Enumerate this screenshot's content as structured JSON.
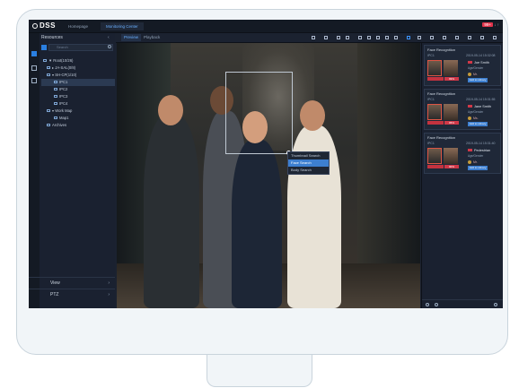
{
  "app": {
    "logo": "DSS",
    "tabs": [
      {
        "label": "Homepage"
      },
      {
        "label": "Monitoring Center"
      }
    ],
    "window_controls": {
      "badge": "99+",
      "text": "↓ ↑"
    }
  },
  "sidebar": {
    "title": "Resources",
    "search_placeholder": "Search",
    "tree": [
      {
        "label": "▼ Root(10/26)",
        "indent": 0
      },
      {
        "label": "▸ JA-SAL(0/8)",
        "indent": 1
      },
      {
        "label": "▾ SH-CP(1/10)",
        "indent": 1
      },
      {
        "label": "IPC1",
        "indent": 3
      },
      {
        "label": "IPC2",
        "indent": 3
      },
      {
        "label": "IPC3",
        "indent": 3
      },
      {
        "label": "IPC4",
        "indent": 3
      },
      {
        "label": "▾ Work Map",
        "indent": 1
      },
      {
        "label": "Map1",
        "indent": 3
      },
      {
        "label": "Archives",
        "indent": 1
      }
    ],
    "bottom": [
      {
        "label": "View"
      },
      {
        "label": "PTZ"
      }
    ]
  },
  "toolbar": {
    "tabs": [
      "Preview",
      "Playback"
    ]
  },
  "context_menu": {
    "items": [
      "Thumbnail Search",
      "Face Search",
      "Body Search"
    ],
    "highlighted_index": 1
  },
  "panel": {
    "cards": [
      {
        "title": "Face Recognition",
        "channel": "IPC1",
        "time": "2019-05-14 15:32:08",
        "name": "Joe Smith",
        "sub": "Age/Gender",
        "action": "Mr.",
        "similarity": "99%",
        "button": "Add to Library"
      },
      {
        "title": "Face Recognition",
        "channel": "IPC1",
        "time": "2019-05-14 15:31:55",
        "name": "Jane Smith",
        "sub": "Age/Gender",
        "action": "Ms.",
        "similarity": "95%",
        "button": "Add to Library"
      },
      {
        "title": "Face Recognition",
        "channel": "IPC1",
        "time": "2019-05-14 15:31:40",
        "name": "Pedestrian",
        "sub": "Age/Gender",
        "action": "Mr.",
        "similarity": "90%",
        "button": "Add to Library"
      }
    ]
  }
}
